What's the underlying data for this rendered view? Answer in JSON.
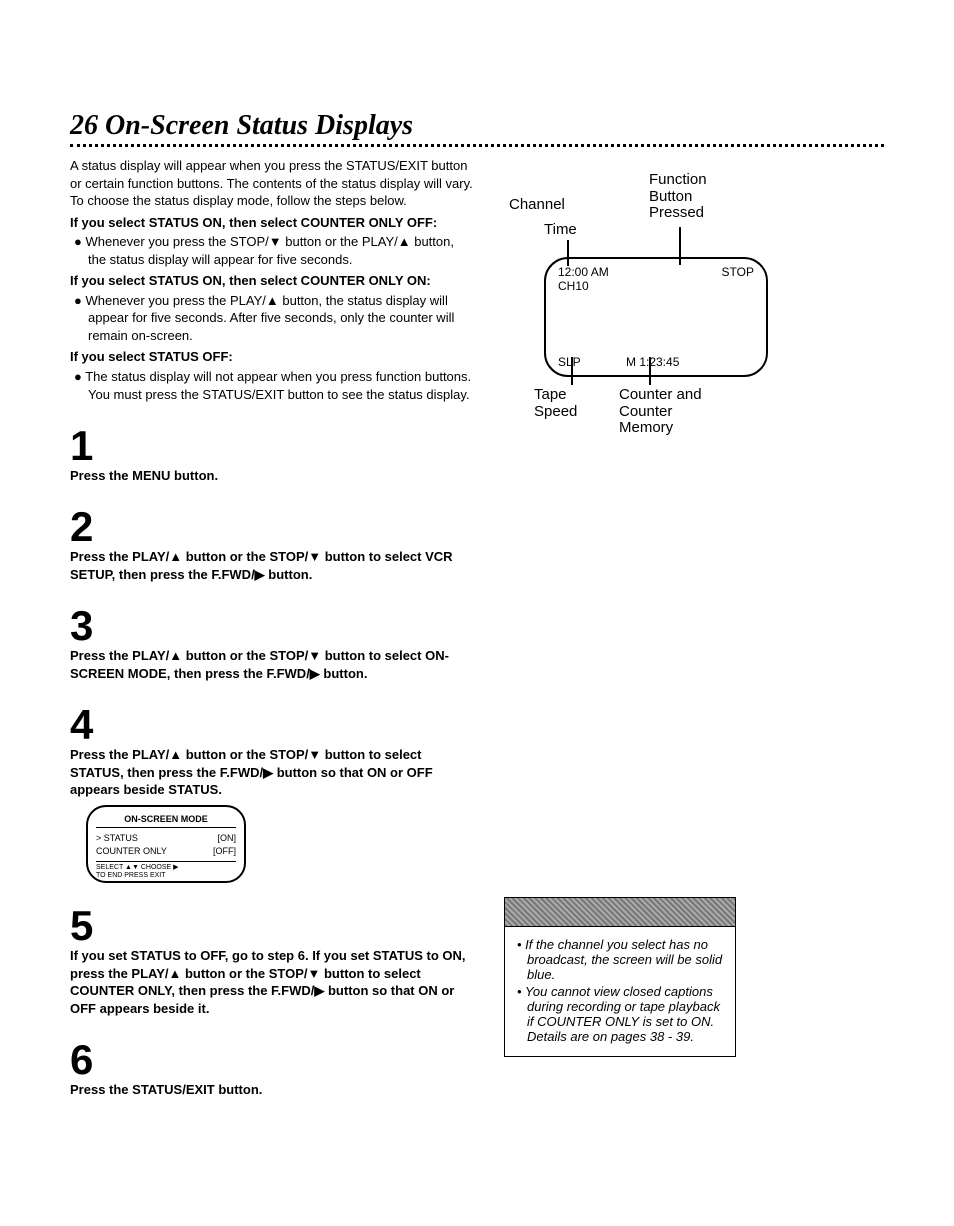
{
  "title": "26  On-Screen Status Displays",
  "intro": "A status display will appear when you press the STATUS/EXIT button or certain function buttons. The contents of the status display will vary. To choose the status display mode, follow the steps below.",
  "if1": "If you select STATUS ON, then select COUNTER ONLY OFF:",
  "bul1": "Whenever you press the STOP/▼ button or the PLAY/▲ button, the status display will appear for five seconds.",
  "if2": "If you select STATUS ON, then select COUNTER ONLY ON:",
  "bul2": "Whenever you press the PLAY/▲ button, the status display will appear for five seconds. After five seconds, only the counter will remain on-screen.",
  "if3": "If you select STATUS OFF:",
  "bul3": "The status display will not appear when you press function buttons. You must press the STATUS/EXIT button to see the status display.",
  "steps": {
    "n1": "1",
    "d1": "Press the MENU button.",
    "n2": "2",
    "d2": "Press the PLAY/▲ button or the STOP/▼ button to select VCR SETUP, then press the F.FWD/▶ button.",
    "n3": "3",
    "d3": "Press the PLAY/▲ button or the STOP/▼ button to select ON-SCREEN MODE, then press the F.FWD/▶ button.",
    "n4": "4",
    "d4": "Press the PLAY/▲ button or the STOP/▼ button to select STATUS, then press the F.FWD/▶ button so that ON or OFF appears beside STATUS.",
    "n5": "5",
    "d5": "If you set STATUS to OFF, go to step 6. If you set STATUS to ON, press the PLAY/▲ button or the STOP/▼ button to select COUNTER ONLY, then press the F.FWD/▶ button so that ON or OFF appears beside it.",
    "n6": "6",
    "d6": "Press the STATUS/EXIT button."
  },
  "diagram": {
    "channel": "Channel",
    "time": "Time",
    "func": "Function Button Pressed",
    "timeval": "12:00 AM",
    "chval": "CH10",
    "stop": "STOP",
    "slp": "SLP",
    "counterval": "M  1:23:45",
    "tapespeed": "Tape Speed",
    "counter": "Counter and Counter Memory"
  },
  "menu": {
    "title": "ON-SCREEN MODE",
    "r1a": "> STATUS",
    "r1b": "[ON]",
    "r2a": "   COUNTER ONLY",
    "r2b": "[OFF]",
    "f1": "SELECT ▲▼ CHOOSE ▶",
    "f2": "TO  END  PRESS  EXIT"
  },
  "hints": {
    "h1": "If the channel you select has no broadcast, the screen will be solid blue.",
    "h2": "You cannot view closed captions during recording or tape playback if COUNTER ONLY is set to ON. Details are on pages 38 - 39."
  }
}
